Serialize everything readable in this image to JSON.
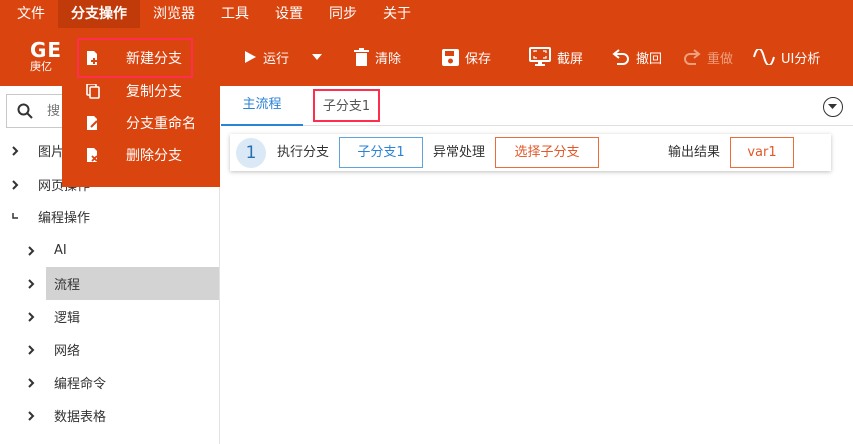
{
  "menubar": {
    "items": [
      "文件",
      "分支操作",
      "浏览器",
      "工具",
      "设置",
      "同步",
      "关于"
    ]
  },
  "logo": {
    "big": "GE",
    "small": "庚亿"
  },
  "toolbar": {
    "run": "运行",
    "clear": "清除",
    "save": "保存",
    "screenshot": "截屏",
    "undo": "撤回",
    "redo": "重做",
    "ui_analysis": "UI分析"
  },
  "dropdown": {
    "items": [
      "新建分支",
      "复制分支",
      "分支重命名",
      "删除分支"
    ]
  },
  "search": {
    "placeholder": "搜"
  },
  "tree": {
    "items": [
      "图片",
      "网页操作",
      "编程操作",
      "AI",
      "流程",
      "逻辑",
      "网络",
      "编程命令",
      "数据表格"
    ]
  },
  "tabs": {
    "main": "主流程",
    "sub": "子分支1"
  },
  "step": {
    "number": "1",
    "exec_label": "执行分支",
    "branch_value": "子分支1",
    "exception_label": "异常处理",
    "select_branch": "选择子分支",
    "output_label": "输出结果",
    "output_value": "var1"
  },
  "colors": {
    "brand": "#d9440f",
    "accent_blue": "#2a83d6",
    "highlight_red": "#ff2e4e",
    "orange": "#e2582a"
  }
}
